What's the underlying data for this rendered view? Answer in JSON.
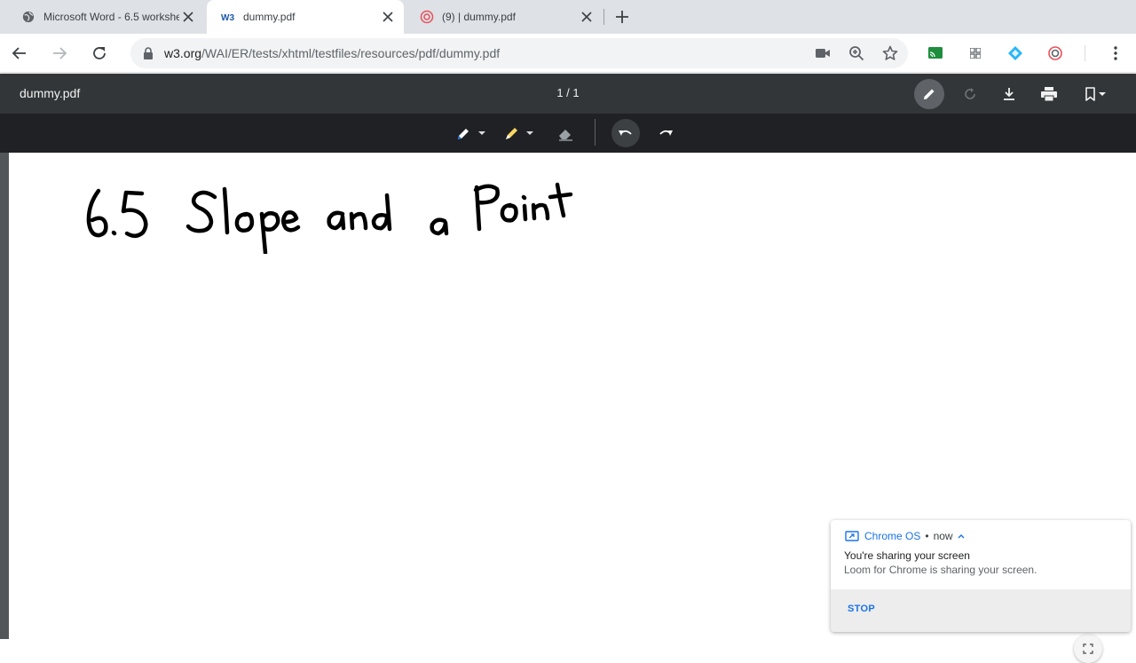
{
  "tabs": [
    {
      "title": "Microsoft Word - 6.5 worksheet",
      "favicon": "globe-icon"
    },
    {
      "title": "dummy.pdf",
      "favicon": "w3c-icon"
    },
    {
      "title": "(9) | dummy.pdf",
      "favicon": "loom-icon"
    }
  ],
  "toolbar": {
    "url_host": "w3.org",
    "url_path": "/WAI/ER/tests/xhtml/testfiles/resources/pdf/dummy.pdf"
  },
  "pdf_viewer": {
    "title": "dummy.pdf",
    "page_indicator": "1 / 1"
  },
  "document": {
    "handwritten_text": "6.5 Slope and a Point"
  },
  "notification": {
    "source": "Chrome OS",
    "time": "now",
    "title": "You're sharing your screen",
    "body": "Loom for Chrome is sharing your screen.",
    "action": "STOP"
  },
  "colors": {
    "accent": "#1a73e8",
    "pdf_toolbar": "#323639",
    "annotation_bar": "#202124",
    "tabstrip": "#dee1e6"
  }
}
